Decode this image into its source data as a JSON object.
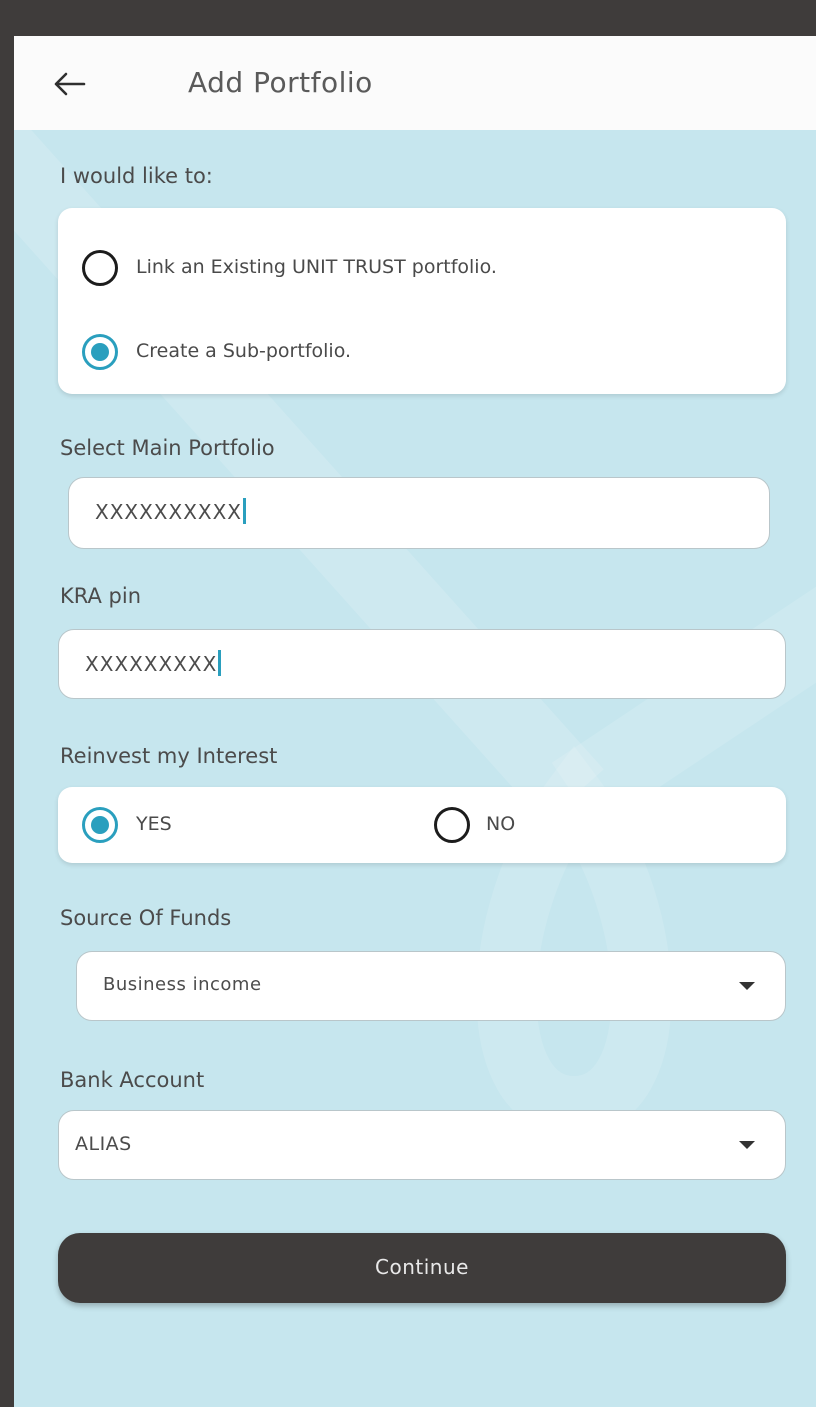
{
  "header": {
    "back_icon": "arrow-left-icon",
    "title": "Add Portfolio"
  },
  "form": {
    "intent_label": "I would like to:",
    "intent_options": [
      {
        "label": "Link an Existing UNIT TRUST portfolio.",
        "selected": false
      },
      {
        "label": "Create a Sub-portfolio.",
        "selected": true
      }
    ],
    "main_portfolio": {
      "label": "Select Main Portfolio",
      "value": "XXXXXXXXXX"
    },
    "kra_pin": {
      "label": "KRA pin",
      "value": "XXXXXXXXX"
    },
    "reinvest": {
      "label": "Reinvest my Interest",
      "options": [
        {
          "label": "YES",
          "selected": true
        },
        {
          "label": "NO",
          "selected": false
        }
      ]
    },
    "source_of_funds": {
      "label": "Source Of Funds",
      "value": "Business income"
    },
    "bank_account": {
      "label": "Bank Account",
      "value": "ALIAS"
    },
    "continue_label": "Continue"
  },
  "colors": {
    "accent": "#2a9fbe",
    "background": "#c6e6ee",
    "button": "#3f3c3b",
    "frame": "#3f3c3b"
  }
}
